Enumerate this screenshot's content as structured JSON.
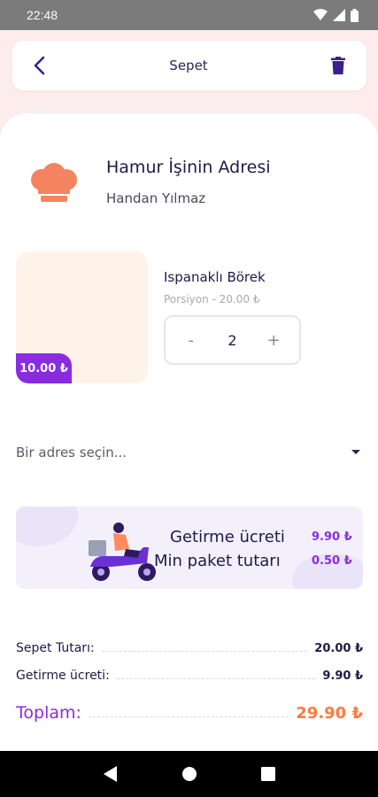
{
  "status_bar": {
    "time": "22:48"
  },
  "header": {
    "title": "Sepet"
  },
  "shop": {
    "name": "Hamur İşinin Adresi",
    "owner": "Handan Yılmaz"
  },
  "product": {
    "name": "Ispanaklı Börek",
    "subtitle": "Porsiyon - 20.00 ₺",
    "price_tag": "10.00 ₺",
    "quantity": "2",
    "minus": "-",
    "plus": "+"
  },
  "address": {
    "placeholder": "Bir adres seçin..."
  },
  "delivery": {
    "fee_label": "Getirme ücreti",
    "fee_value": "9.90 ₺",
    "min_label": "Min paket tutarı",
    "min_value": "0.50 ₺"
  },
  "summary": {
    "subtotal_label": "Sepet Tutarı:",
    "subtotal_value": "20.00 ₺",
    "delivery_label": "Getirme ücreti:",
    "delivery_value": "9.90 ₺",
    "total_label": "Toplam:",
    "total_value": "29.90 ₺"
  },
  "colors": {
    "accent": "#8a2be2",
    "orange": "#ff7a3d",
    "text": "#1f1a47"
  },
  "icons": [
    "back-arrow-icon",
    "trash-icon",
    "chef-hat-icon",
    "dropdown-arrow-icon",
    "scooter-icon",
    "nav-back-icon",
    "nav-home-icon",
    "nav-recents-icon",
    "wifi-icon",
    "signal-icon",
    "battery-icon"
  ]
}
